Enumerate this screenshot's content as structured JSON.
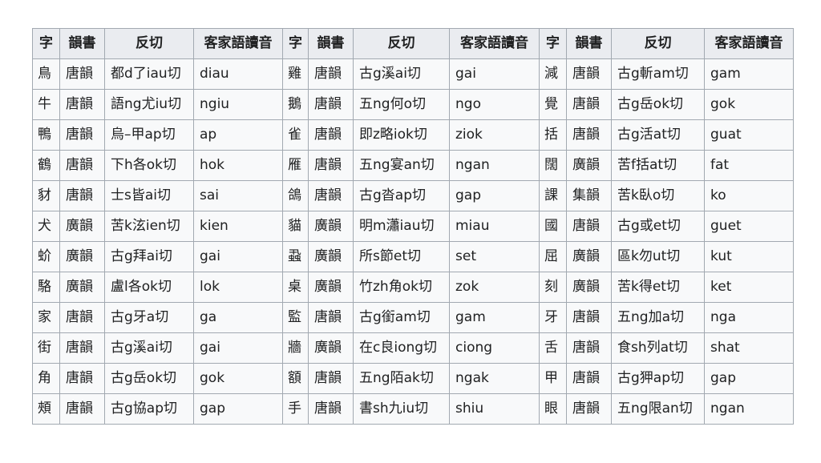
{
  "table": {
    "headers": [
      "字",
      "韻書",
      "反切",
      "客家語讀音",
      "字",
      "韻書",
      "反切",
      "客家語讀音",
      "字",
      "韻書",
      "反切",
      "客家語讀音"
    ],
    "rows": [
      [
        "鳥",
        "唐韻",
        "都d了iau切",
        "diau",
        "雞",
        "唐韻",
        "古g溪ai切",
        "gai",
        "減",
        "唐韻",
        "古g斬am切",
        "gam"
      ],
      [
        "牛",
        "唐韻",
        "語ng尤iu切",
        "ngiu",
        "鵝",
        "唐韻",
        "五ng何o切",
        "ngo",
        "覺",
        "唐韻",
        "古g岳ok切",
        "gok"
      ],
      [
        "鴨",
        "唐韻",
        "烏–甲ap切",
        "ap",
        "雀",
        "唐韻",
        "即z略iok切",
        "ziok",
        "括",
        "唐韻",
        "古g活at切",
        "guat"
      ],
      [
        "鶴",
        "唐韻",
        "下h各ok切",
        "hok",
        "雁",
        "唐韻",
        "五ng宴an切",
        "ngan",
        "闊",
        "廣韻",
        "苦f括at切",
        "fat"
      ],
      [
        "豺",
        "唐韻",
        "士s皆ai切",
        "sai",
        "鴿",
        "唐韻",
        "古g沓ap切",
        "gap",
        "課",
        "集韻",
        "苦k臥o切",
        "ko"
      ],
      [
        "犬",
        "廣韻",
        "苦k泫ien切",
        "kien",
        "貓",
        "廣韻",
        "明m瀟iau切",
        "miau",
        "國",
        "唐韻",
        "古g或et切",
        "guet"
      ],
      [
        "蚧",
        "廣韻",
        "古g拜ai切",
        "gai",
        "蝨",
        "廣韻",
        "所s節et切",
        "set",
        "屈",
        "廣韻",
        "區k勿ut切",
        "kut"
      ],
      [
        "駱",
        "廣韻",
        "盧l各ok切",
        "lok",
        "桌",
        "廣韻",
        "竹zh角ok切",
        "zok",
        "刻",
        "廣韻",
        "苦k得et切",
        "ket"
      ],
      [
        "家",
        "唐韻",
        "古g牙a切",
        "ga",
        "監",
        "唐韻",
        "古g銜am切",
        "gam",
        "牙",
        "唐韻",
        "五ng加a切",
        "nga"
      ],
      [
        "街",
        "唐韻",
        "古g溪ai切",
        "gai",
        "牆",
        "廣韻",
        "在c良iong切",
        "ciong",
        "舌",
        "唐韻",
        "食sh列at切",
        "shat"
      ],
      [
        "角",
        "唐韻",
        "古g岳ok切",
        "gok",
        "額",
        "唐韻",
        "五ng陌ak切",
        "ngak",
        "甲",
        "唐韻",
        "古g狎ap切",
        "gap"
      ],
      [
        "頰",
        "唐韻",
        "古g協ap切",
        "gap",
        "手",
        "唐韻",
        "書sh九iu切",
        "shiu",
        "眼",
        "唐韻",
        "五ng限an切",
        "ngan"
      ]
    ]
  }
}
